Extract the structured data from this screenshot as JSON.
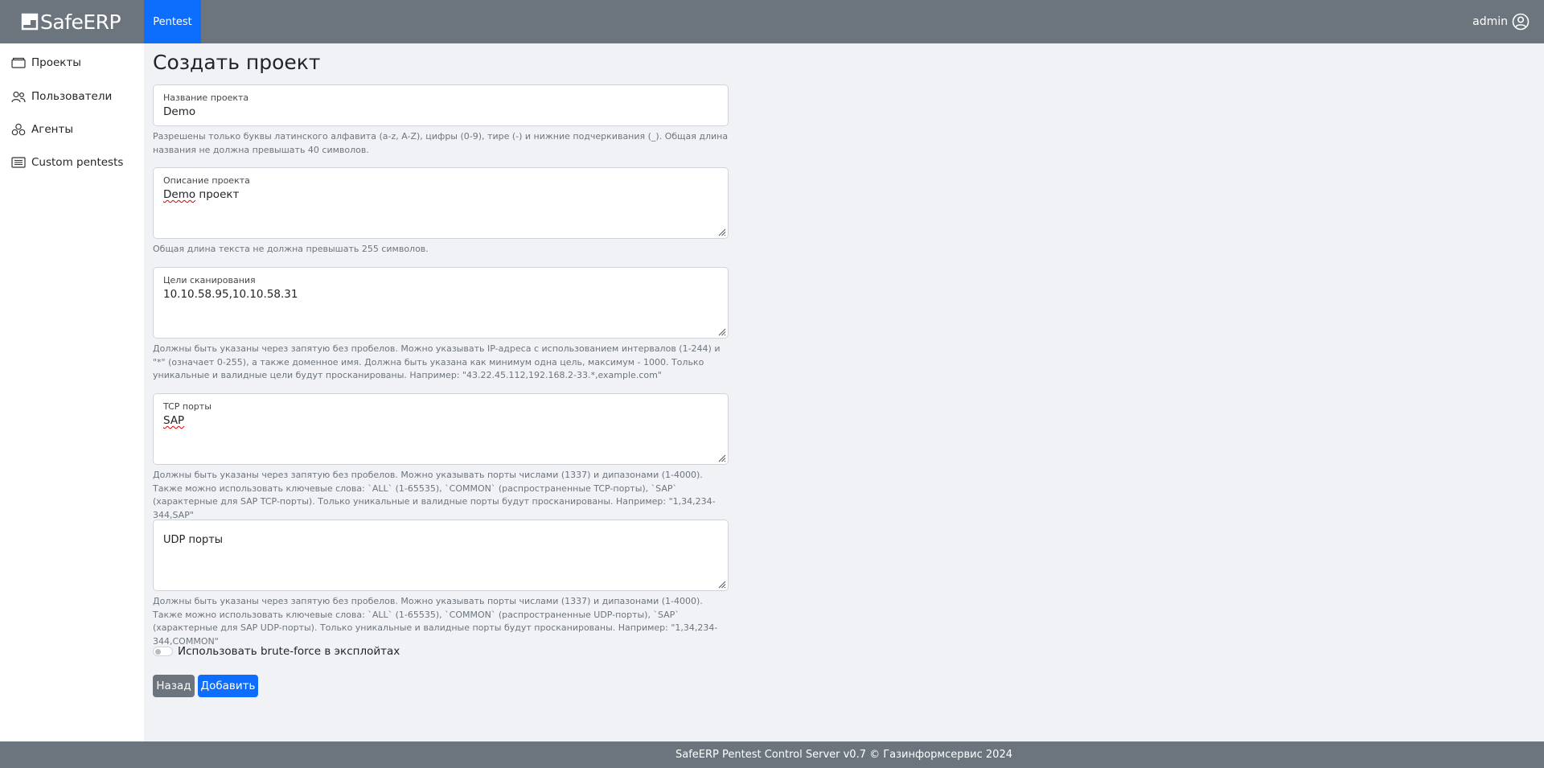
{
  "header": {
    "logo_text": "SafeERP",
    "active_tab": "Pentest",
    "user_name": "admin"
  },
  "sidebar": {
    "items": [
      {
        "label": "Проекты",
        "icon": "folder-icon"
      },
      {
        "label": "Пользователи",
        "icon": "users-icon"
      },
      {
        "label": "Агенты",
        "icon": "agents-icon"
      },
      {
        "label": "Custom pentests",
        "icon": "list-icon"
      }
    ]
  },
  "page": {
    "title": "Создать проект"
  },
  "form": {
    "name": {
      "label": "Название проекта",
      "value": "Demo",
      "help": "Разрешены только буквы латинского алфавита (a-z, A-Z), цифры (0-9), тире (-) и нижние подчеркивания (_). Общая длина названия не должна превышать 40 символов."
    },
    "description": {
      "label": "Описание проекта",
      "value_word1": "Demo",
      "value_rest": " проект",
      "help": "Общая длина текста не должна превышать 255 символов."
    },
    "targets": {
      "label": "Цели сканирования",
      "value": "10.10.58.95,10.10.58.31",
      "help": "Должны быть указаны через запятую без пробелов. Можно указывать IP-адреса с использованием интервалов (1-244) и \"*\" (означает 0-255), а также доменное имя. Должна быть указана как минимум одна цель, максимум - 1000. Только уникальные и валидные цели будут просканированы. Например: \"43.22.45.112,192.168.2-33.*,example.com\""
    },
    "tcp": {
      "label": "TCP порты",
      "value": "SAP",
      "help": "Должны быть указаны через запятую без пробелов. Можно указывать порты числами (1337) и дипазонами (1-4000). Также можно использовать ключевые слова: `ALL` (1-65535), `COMMON` (распространенные TCP-порты), `SAP` (характерные для SAP TCP-порты). Только уникальные и валидные порты будут просканированы. Например: \"1,34,234-344,SAP\""
    },
    "udp": {
      "placeholder": "UDP порты",
      "value": "",
      "help": "Должны быть указаны через запятую без пробелов. Можно указывать порты числами (1337) и дипазонами (1-4000). Также можно использовать ключевые слова: `ALL` (1-65535), `COMMON` (распространенные UDP-порты), `SAP` (характерные для SAP UDP-порты). Только уникальные и валидные порты будут просканированы. Например: \"1,34,234-344,COMMON\""
    },
    "bruteforce": {
      "label": "Использовать brute-force в эксплойтах",
      "checked": false
    },
    "buttons": {
      "back": "Назад",
      "add": "Добавить"
    }
  },
  "footer": {
    "text": "SafeERP Pentest Control Server v0.7 © Газинформсервис 2024"
  },
  "colors": {
    "topbar": "#6c757d",
    "primary": "#0d6efd",
    "background": "#f1f2f5"
  }
}
